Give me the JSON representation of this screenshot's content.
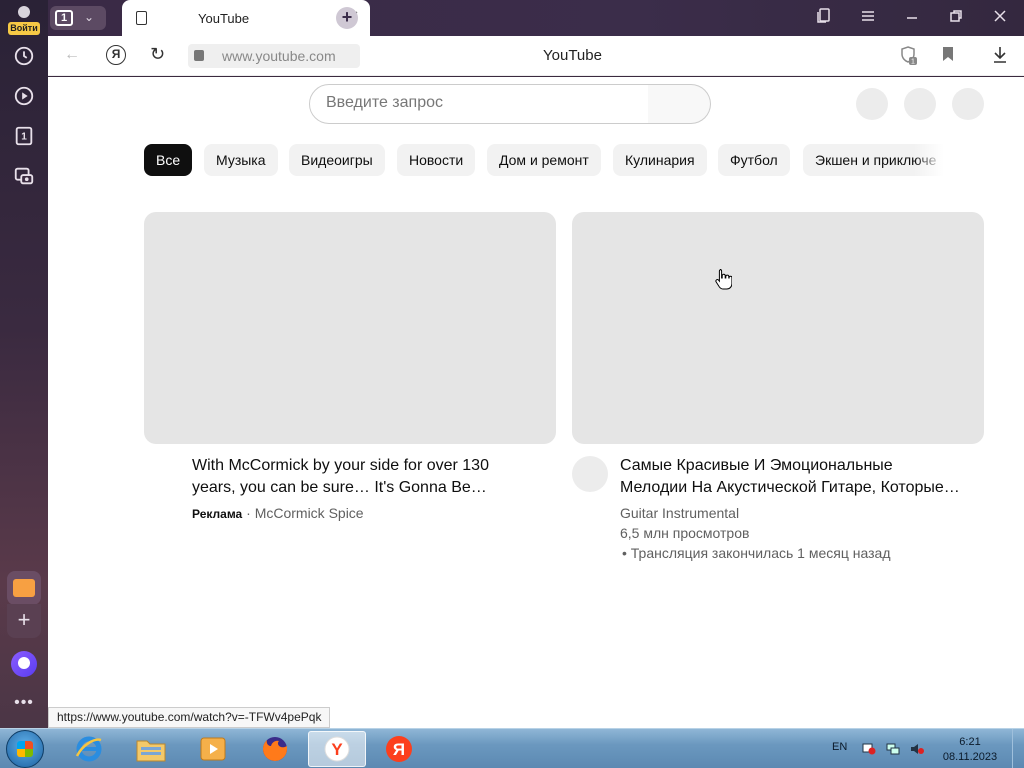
{
  "sidebar": {
    "login_label": "Войти",
    "icons": [
      "history-icon",
      "play-circle-icon",
      "tabs-counter-icon",
      "screenshot-icon"
    ],
    "tab_counter": "1",
    "bottom": [
      "mail-icon",
      "add-icon",
      "alice-icon",
      "more-icon"
    ],
    "more_glyph": "•••"
  },
  "tabstrip": {
    "tab_count": "1",
    "active_tab": {
      "title": "YouTube",
      "close_glyph": "✕"
    },
    "newtab_glyph": "+",
    "window_controls": [
      "collections-icon",
      "menu-icon",
      "minimize-icon",
      "restore-icon",
      "close-icon"
    ]
  },
  "addressbar": {
    "url": "www.youtube.com",
    "page_title": "YouTube",
    "protect_badge": "1",
    "back_glyph": "←",
    "yandex_glyph": "Я",
    "reload_glyph": "↻"
  },
  "youtube": {
    "search_placeholder": "Введите запрос",
    "chips": [
      "Все",
      "Музыка",
      "Видеоигры",
      "Новости",
      "Дом и ремонт",
      "Кулинария",
      "Футбол",
      "Экшен и приключе"
    ],
    "active_chip": "Все",
    "videos": [
      {
        "title_line1": "With McCormick by your side for over 130",
        "title_line2": "years, you can be sure… It's Gonna Be…",
        "ad_label": "Реклама",
        "sep": " · ",
        "channel": "McCormick Spice"
      },
      {
        "title_line1": "Самые Красивые И Эмоциональные",
        "title_line2": "Мелодии На Акустической Гитаре, Которые…",
        "channel": "Guitar Instrumental",
        "views": "6,5 млн просмотров",
        "status": "• Трансляция закончилась 1 месяц назад"
      }
    ]
  },
  "status_url": "https://www.youtube.com/watch?v=-TFWv4pePqk",
  "taskbar": {
    "apps": [
      "internet-explorer-icon",
      "file-explorer-icon",
      "media-player-icon",
      "firefox-icon",
      "yandex-browser-icon",
      "yandex-icon"
    ],
    "lang": "EN",
    "time": "6:21",
    "date": "08.11.2023"
  },
  "colors": {
    "accent_dark": "#0f0f0f",
    "chip_bg": "#f2f2f2",
    "placeholder_gray": "#e5e5e5",
    "sidebar_bg": "#3a2a40",
    "yandex_red": "#fc3f1d"
  }
}
